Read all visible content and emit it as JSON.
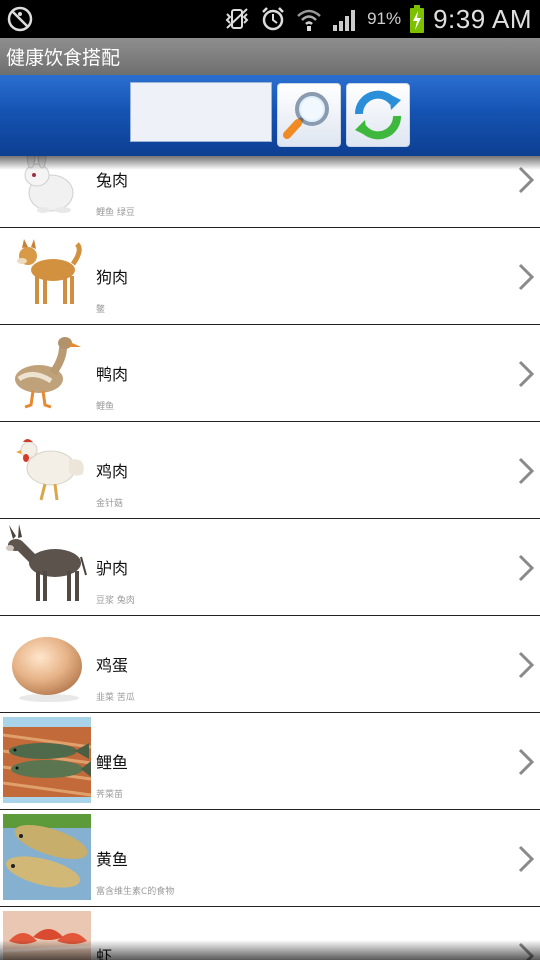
{
  "status_bar": {
    "battery_percent": "91%",
    "time": "9:39 AM",
    "icons": [
      "accessibility-icon",
      "mute-vibrate-icon",
      "alarm-icon",
      "wifi-icon",
      "signal-icon",
      "battery-charging-icon"
    ]
  },
  "app": {
    "title": "健康饮食搭配"
  },
  "toolbar": {
    "search": {
      "value": "",
      "placeholder": ""
    },
    "search_button_icon": "magnifier-icon",
    "refresh_button_icon": "refresh-icon"
  },
  "foods": [
    {
      "name": "兔肉",
      "sub": "鲤鱼 绿豆",
      "icon": "rabbit-photo"
    },
    {
      "name": "狗肉",
      "sub": "鳖",
      "icon": "dog-photo"
    },
    {
      "name": "鸭肉",
      "sub": "鲤鱼",
      "icon": "duck-photo"
    },
    {
      "name": "鸡肉",
      "sub": "金针菇",
      "icon": "chicken-photo"
    },
    {
      "name": "驴肉",
      "sub": "豆浆 兔肉",
      "icon": "donkey-photo"
    },
    {
      "name": "鸡蛋",
      "sub": "韭菜 苦瓜",
      "icon": "egg-photo"
    },
    {
      "name": "鲤鱼",
      "sub": "荠菜苗",
      "icon": "carp-photo"
    },
    {
      "name": "黄鱼",
      "sub": "富含维生素C的食物",
      "icon": "yellow-croaker-photo"
    },
    {
      "name": "虾",
      "sub": "",
      "icon": "shrimp-photo"
    }
  ],
  "colors": {
    "toolbar_top": "#2a6fd0",
    "toolbar_bottom": "#0d3f92",
    "title_bar": "#7f7f7f",
    "battery_green": "#7cc000"
  }
}
